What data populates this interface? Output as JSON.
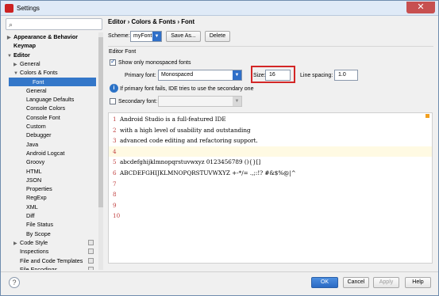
{
  "window": {
    "title": "Settings",
    "close_label": "✕"
  },
  "search": {
    "placeholder": ""
  },
  "tree": [
    {
      "label": "Appearance & Behavior",
      "arrow": "▶",
      "bold": true
    },
    {
      "label": "Keymap",
      "arrow": "",
      "bold": true
    },
    {
      "label": "Editor",
      "arrow": "▼",
      "bold": true
    },
    {
      "label": "General",
      "arrow": "▶"
    },
    {
      "label": "Colors & Fonts",
      "arrow": "▼"
    },
    {
      "label": "Font",
      "arrow": "",
      "selected": true
    },
    {
      "label": "General",
      "arrow": ""
    },
    {
      "label": "Language Defaults",
      "arrow": ""
    },
    {
      "label": "Console Colors",
      "arrow": ""
    },
    {
      "label": "Console Font",
      "arrow": ""
    },
    {
      "label": "Custom",
      "arrow": ""
    },
    {
      "label": "Debugger",
      "arrow": ""
    },
    {
      "label": "Java",
      "arrow": ""
    },
    {
      "label": "Android Logcat",
      "arrow": ""
    },
    {
      "label": "Groovy",
      "arrow": ""
    },
    {
      "label": "HTML",
      "arrow": ""
    },
    {
      "label": "JSON",
      "arrow": ""
    },
    {
      "label": "Properties",
      "arrow": ""
    },
    {
      "label": "RegExp",
      "arrow": ""
    },
    {
      "label": "XML",
      "arrow": ""
    },
    {
      "label": "Diff",
      "arrow": ""
    },
    {
      "label": "File Status",
      "arrow": ""
    },
    {
      "label": "By Scope",
      "arrow": ""
    },
    {
      "label": "Code Style",
      "arrow": "▶",
      "copy": true
    },
    {
      "label": "Inspections",
      "arrow": "",
      "copy": true
    },
    {
      "label": "File and Code Templates",
      "arrow": "",
      "copy": true
    },
    {
      "label": "File Encodings",
      "arrow": "",
      "copy": true
    }
  ],
  "breadcrumb": "Editor › Colors & Fonts › Font",
  "scheme": {
    "label": "Scheme:",
    "value": "myFont",
    "save_as": "Save As...",
    "delete": "Delete"
  },
  "section": "Editor Font",
  "monospaced": {
    "label": "Show only monospaced fonts",
    "checked": true
  },
  "primary_font": {
    "label": "Primary font:",
    "value": "Monospaced"
  },
  "size": {
    "label": "Size:",
    "value": "16"
  },
  "line_spacing": {
    "label": "Line spacing:",
    "value": "1.0"
  },
  "hint": "If primary font fails, IDE tries to use the secondary one",
  "secondary_font": {
    "label": "Secondary font:",
    "value": "",
    "checked": false
  },
  "preview_lines": [
    {
      "n": "1",
      "text": "Android Studio is a full-featured IDE"
    },
    {
      "n": "2",
      "text": "with a high level of usability and outstanding"
    },
    {
      "n": "3",
      "text": "advanced code editing and refactoring support."
    },
    {
      "n": "4",
      "text": ""
    },
    {
      "n": "5",
      "text": "abcdefghijklmnopqrstuvwxyz 0123456789 (){}[]"
    },
    {
      "n": "6",
      "text": "ABCDEFGHIJKLMNOPQRSTUVWXYZ +-*/= .,;:!? #&$%@|^"
    },
    {
      "n": "7",
      "text": ""
    },
    {
      "n": "8",
      "text": ""
    },
    {
      "n": "9",
      "text": ""
    },
    {
      "n": "10",
      "text": ""
    }
  ],
  "buttons": {
    "ok": "OK",
    "cancel": "Cancel",
    "apply": "Apply",
    "help": "Help"
  },
  "colors": {
    "selection": "#3477c9",
    "highlight_box": "#d32626",
    "ok_button": "#2b6ac3"
  }
}
